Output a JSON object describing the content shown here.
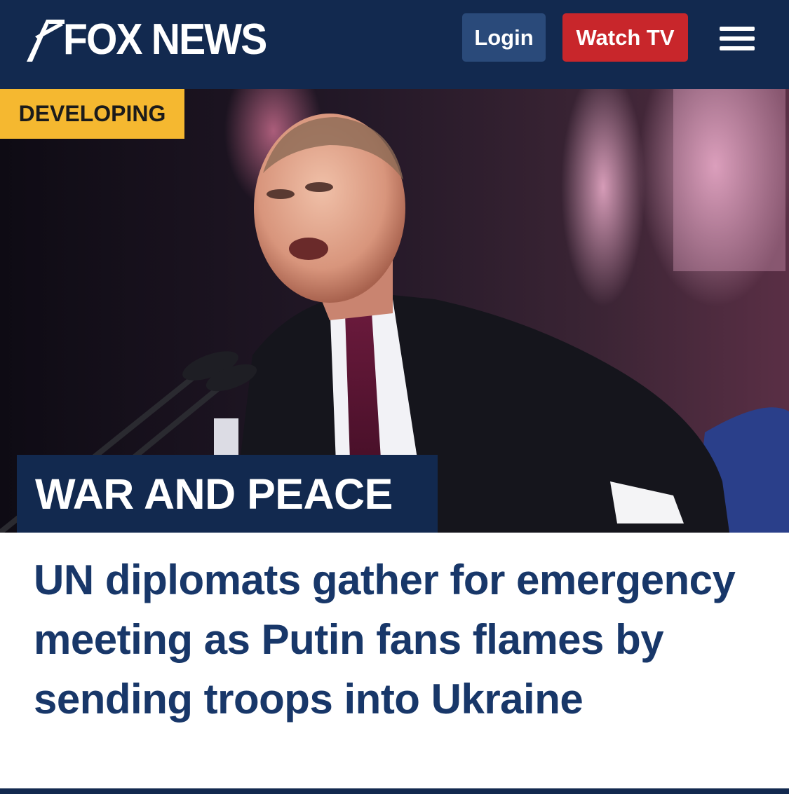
{
  "header": {
    "logo_text": "FOX NEWS",
    "login_label": "Login",
    "watch_label": "Watch TV",
    "menu_icon": "hamburger-menu-icon"
  },
  "hero": {
    "badge": "DEVELOPING",
    "kicker": "WAR AND PEACE"
  },
  "article": {
    "headline": "UN diplomats gather for emergency meeting as Putin fans flames by sending troops into Ukraine"
  },
  "colors": {
    "brand_navy": "#12294f",
    "watch_red": "#c8262b",
    "login_blue": "#2a4a7a",
    "badge_yellow": "#f5b830",
    "headline_blue": "#183769"
  }
}
